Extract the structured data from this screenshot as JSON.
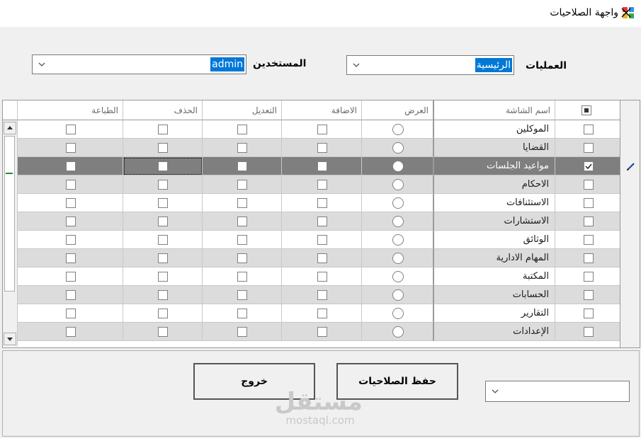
{
  "window": {
    "title": "واجهة الصلاحيات"
  },
  "filters": {
    "operations_label": "العمليات",
    "operations_value": "الرئيسية",
    "users_label": "المستخدين",
    "users_value": "admin"
  },
  "grid": {
    "columns": {
      "screen_name": "اسم الشاشة",
      "view": "العرض",
      "add": "الاضافة",
      "edit": "التعديل",
      "delete": "الحذف",
      "print": "الطباعة"
    },
    "rows": [
      {
        "name": "الموكلين",
        "selected": false
      },
      {
        "name": "القضايا",
        "selected": false
      },
      {
        "name": "مواعيد الجلسات",
        "selected": true
      },
      {
        "name": "الاحكام",
        "selected": false
      },
      {
        "name": "الاستئنافات",
        "selected": false
      },
      {
        "name": "الاستشارات",
        "selected": false
      },
      {
        "name": "الوثائق",
        "selected": false
      },
      {
        "name": "المهام الادارية",
        "selected": false
      },
      {
        "name": "المكتبة",
        "selected": false
      },
      {
        "name": "الحسابات",
        "selected": false
      },
      {
        "name": "التقارير",
        "selected": false
      },
      {
        "name": "الإعدادات",
        "selected": false
      }
    ]
  },
  "actions": {
    "save_label": "حفظ الصلاحيات",
    "exit_label": "خروج"
  },
  "bottom_combo_value": "",
  "watermark": {
    "arabic": "مستقل",
    "latin": "mostaql.com"
  },
  "colors": {
    "selection": "#0078d7",
    "selected_row": "#7f7f7f",
    "alt_row": "#dcdcdc"
  }
}
